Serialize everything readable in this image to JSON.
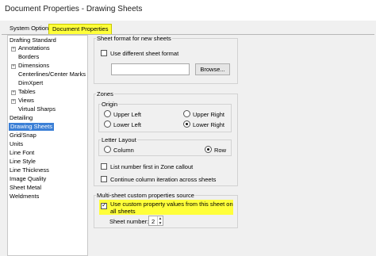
{
  "window": {
    "title": "Document Properties - Drawing Sheets"
  },
  "tabs": {
    "system": "System Options",
    "document": "Document Properties"
  },
  "tree": {
    "items": [
      {
        "label": "Drafting Standard"
      },
      {
        "label": "Annotations"
      },
      {
        "label": "Borders"
      },
      {
        "label": "Dimensions"
      },
      {
        "label": "Centerlines/Center Marks"
      },
      {
        "label": "DimXpert"
      },
      {
        "label": "Tables"
      },
      {
        "label": "Views"
      },
      {
        "label": "Virtual Sharps"
      },
      {
        "label": "Detailing"
      },
      {
        "label": "Drawing Sheets"
      },
      {
        "label": "Grid/Snap"
      },
      {
        "label": "Units"
      },
      {
        "label": "Line Font"
      },
      {
        "label": "Line Style"
      },
      {
        "label": "Line Thickness"
      },
      {
        "label": "Image Quality"
      },
      {
        "label": "Sheet Metal"
      },
      {
        "label": "Weldments"
      }
    ],
    "expand_glyph": "+"
  },
  "sheet_format": {
    "title": "Sheet format for new sheets",
    "use_different_label": "Use different sheet format",
    "use_different_checked": false,
    "path_value": "",
    "browse_label": "Browse..."
  },
  "zones": {
    "title": "Zones",
    "origin": {
      "title": "Origin",
      "upper_left": "Upper Left",
      "upper_right": "Upper Right",
      "lower_left": "Lower Left",
      "lower_right": "Lower Right",
      "selected": "Lower Right"
    },
    "letter_layout": {
      "title": "Letter Layout",
      "column": "Column",
      "row": "Row",
      "selected": "Row"
    },
    "list_number_first": "List number first in Zone callout",
    "continue_iteration": "Continue column iteration across sheets"
  },
  "multi_sheet": {
    "title": "Multi-sheet custom properties source",
    "use_custom_line1": "Use custom property values from this sheet on",
    "use_custom_line2": "all sheets",
    "use_custom_checked": true,
    "sheet_number_label": "Sheet number:",
    "sheet_number_value": "2"
  },
  "colors": {
    "highlight": "#ffff3a",
    "selection": "#3b7fd6"
  }
}
